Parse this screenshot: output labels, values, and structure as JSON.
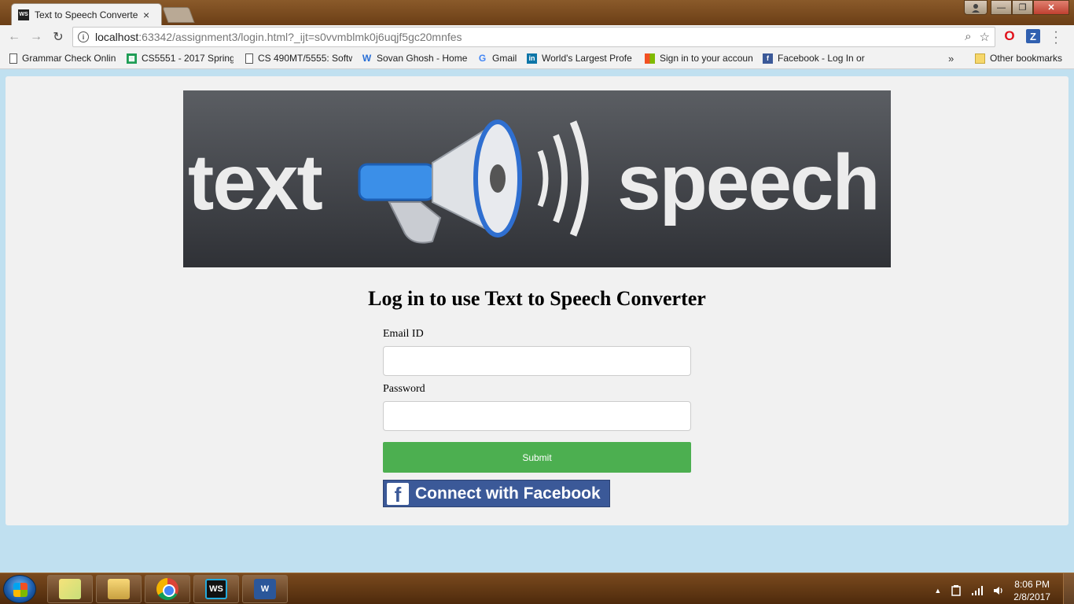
{
  "browser": {
    "tab": {
      "favicon_text": "WS",
      "title": "Text to Speech Converter",
      "close": "×"
    },
    "window_buttons": {
      "minimize": "—",
      "maximize": "❐",
      "close": "✕"
    },
    "nav": {
      "back": "←",
      "forward": "→",
      "reload": "↻"
    },
    "address": {
      "host": "localhost",
      "rest": ":63342/assignment3/login.html?_ijt=s0vvmblmk0j6uqjf5gc20mnfes"
    },
    "omnibox_icons": {
      "zoom": "⌕",
      "star": "☆"
    },
    "extensions": {
      "opera": "O",
      "z": "Z"
    },
    "bookmarks": [
      {
        "label": "Grammar Check Onlin",
        "icon": "page-icon"
      },
      {
        "label": "CS5551 - 2017 Spring",
        "icon": "sheets-icon"
      },
      {
        "label": "CS 490MT/5555: Softw",
        "icon": "page-icon"
      },
      {
        "label": "Sovan Ghosh - Home",
        "icon": "w-icon"
      },
      {
        "label": "Gmail",
        "icon": "google-icon"
      },
      {
        "label": "World's Largest Profe",
        "icon": "linkedin-icon"
      },
      {
        "label": "Sign in to your accoun",
        "icon": "microsoft-icon"
      },
      {
        "label": "Facebook - Log In or",
        "icon": "facebook-icon"
      }
    ],
    "bookmarks_more": "»",
    "other_bookmarks": "Other bookmarks"
  },
  "page": {
    "banner": {
      "word_left": "text",
      "word_right": "speech"
    },
    "heading": "Log in to use Text to Speech Converter",
    "form": {
      "email_label": "Email ID",
      "email_value": "",
      "password_label": "Password",
      "password_value": "",
      "submit_label": "Submit",
      "facebook_label": "Connect with Facebook"
    }
  },
  "taskbar": {
    "apps": [
      "sticky-notes",
      "file-explorer",
      "chrome",
      "webstorm",
      "word"
    ],
    "ws_label": "WS",
    "word_label": "W",
    "clock_time": "8:06 PM",
    "clock_date": "2/8/2017",
    "tray_arrow": "▲"
  },
  "colors": {
    "submit_green": "#4caf50",
    "facebook_blue": "#3b5998",
    "page_background": "#c0e0f0",
    "card_background": "#f1f1f1"
  }
}
